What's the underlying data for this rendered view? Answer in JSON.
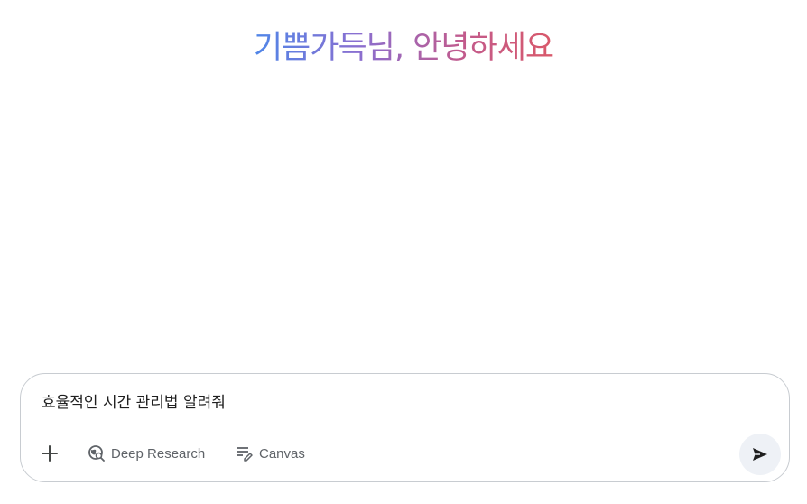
{
  "greeting": {
    "text": "기쁨가득님, 안녕하세요"
  },
  "composer": {
    "input_value": "효율적인 시간 관리법 알려줘",
    "tools": {
      "add_icon": "plus-icon",
      "deep_research_label": "Deep Research",
      "deep_research_icon": "globe-search-icon",
      "canvas_label": "Canvas",
      "canvas_icon": "canvas-edit-icon",
      "send_icon": "send-icon"
    }
  },
  "colors": {
    "gradient_start": "#4f86e8",
    "gradient_mid": "#8a6fd0",
    "gradient_end": "#d9596a",
    "text": "#1f1f1f",
    "muted": "#5f6368",
    "send_bg": "#eef1f6",
    "border": "#c8ccd1"
  }
}
